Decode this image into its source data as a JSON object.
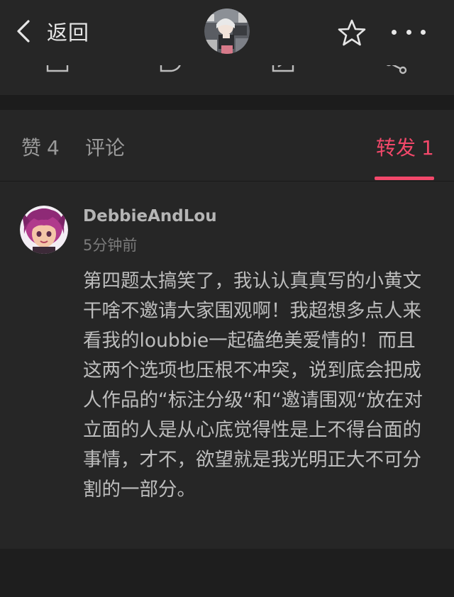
{
  "nav": {
    "back_label": "返回",
    "back_icon": "chevron-left-icon",
    "star_icon": "star-outline-icon",
    "more_icon": "more-dots-icon",
    "avatar_icon": "author-avatar"
  },
  "tabs": {
    "likes_label": "赞",
    "likes_count": "4",
    "comments_label": "评论",
    "reposts_label": "转发",
    "reposts_count": "1",
    "active_color": "#f2486a"
  },
  "reposts": [
    {
      "user_name": "DebbieAndLou",
      "time": "5分钟前",
      "content": "第四题太搞笑了，我认认真真写的小黄文干啥不邀请大家围观啊！我超想多点人来看我的loubbie一起磕绝美爱情的！而且这两个选项也压根不冲突，说到底会把成人作品的“标注分级“和“邀请围观“放在对立面的人是从心底觉得性是上不得台面的事情，才不，欲望就是我光明正大不可分割的一部分。"
    }
  ]
}
